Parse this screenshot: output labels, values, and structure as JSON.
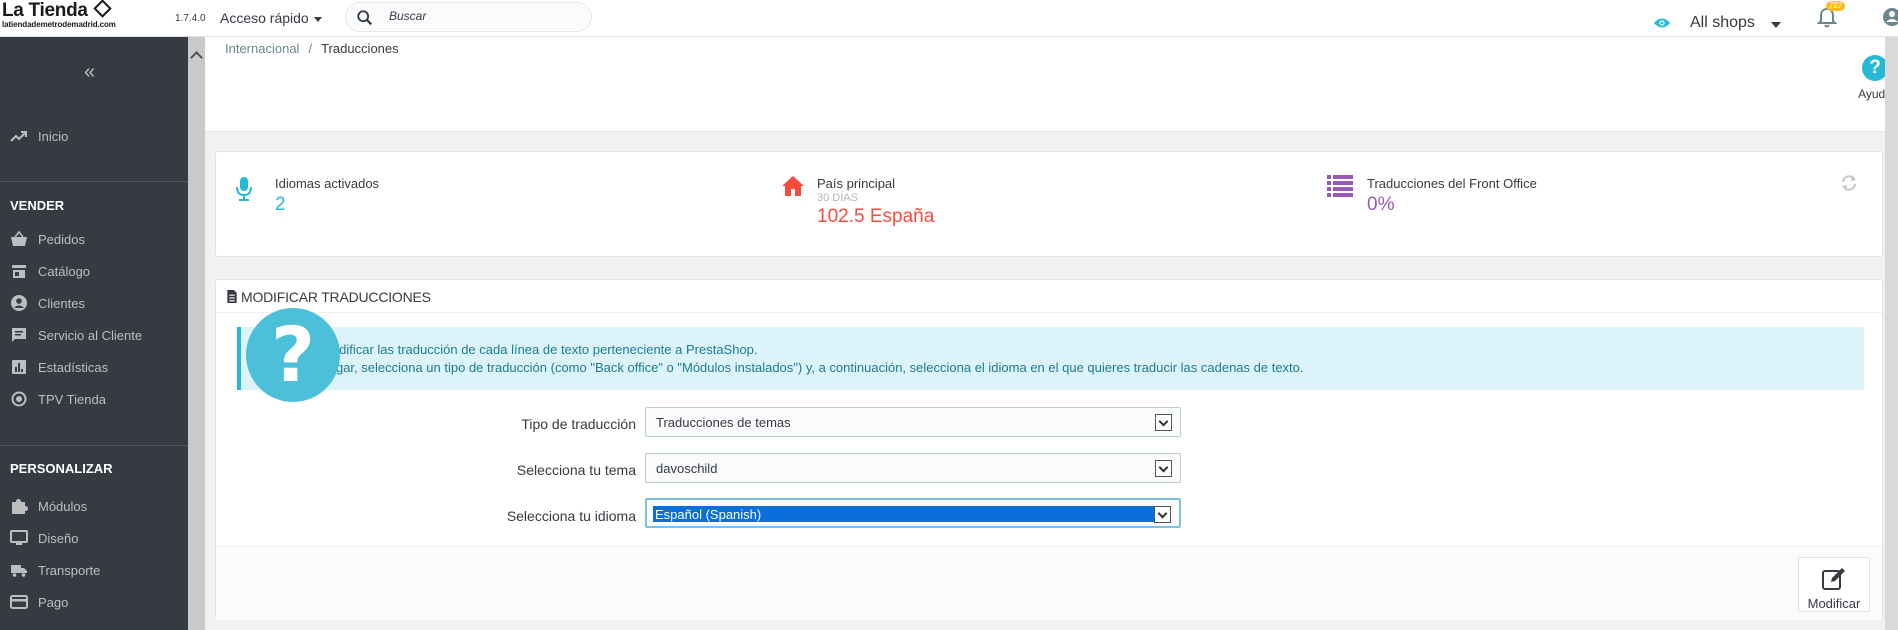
{
  "header": {
    "logo_title": "La Tienda",
    "logo_subtitle": "latiendademetrodemadrid.com",
    "version": "1.7.4.0",
    "quick_access": "Acceso rápido",
    "search_placeholder": "Buscar",
    "shop_selector": "All shops",
    "notifications_count": "727"
  },
  "sidebar": {
    "collapse": "«",
    "home": "Inicio",
    "section_sell": "VENDER",
    "sell_items": [
      "Pedidos",
      "Catálogo",
      "Clientes",
      "Servicio al Cliente",
      "Estadísticas",
      "TPV Tienda"
    ],
    "section_customize": "PERSONALIZAR",
    "customize_items": [
      "Módulos",
      "Diseño",
      "Transporte",
      "Pago"
    ]
  },
  "breadcrumb": {
    "parent": "Internacional",
    "separator": "/",
    "current": "Traducciones"
  },
  "help": {
    "icon": "?",
    "label": "Ayuda"
  },
  "kpis": [
    {
      "title": "Idiomas activados",
      "subtitle": "",
      "value": "2",
      "color": "#25b9d7"
    },
    {
      "title": "País principal",
      "subtitle": "30 DÍAS",
      "value": "102.5 España",
      "color": "#f54c3e"
    },
    {
      "title": "Traducciones del Front Office",
      "subtitle": "",
      "value": "0%",
      "color": "#9b59b6"
    }
  ],
  "panel": {
    "title": "MODIFICAR TRADUCCIONES",
    "alert_line1": "uedes modificar las traducción de cada línea de texto perteneciente a PrestaShop.",
    "alert_line2": "n p    er lugar, selecciona un tipo de traducción (como \"Back office\" o \"Módulos instalados\") y, a continuación, selecciona el idioma en el que quieres traducir las cadenas de texto.",
    "help_icon": "?",
    "fields": [
      {
        "label": "Tipo de traducción",
        "value": "Traducciones de temas"
      },
      {
        "label": "Selecciona tu tema",
        "value": "davoschild"
      },
      {
        "label": "Selecciona tu idioma",
        "value": "Español (Spanish)"
      }
    ],
    "submit_label": "Modificar"
  }
}
